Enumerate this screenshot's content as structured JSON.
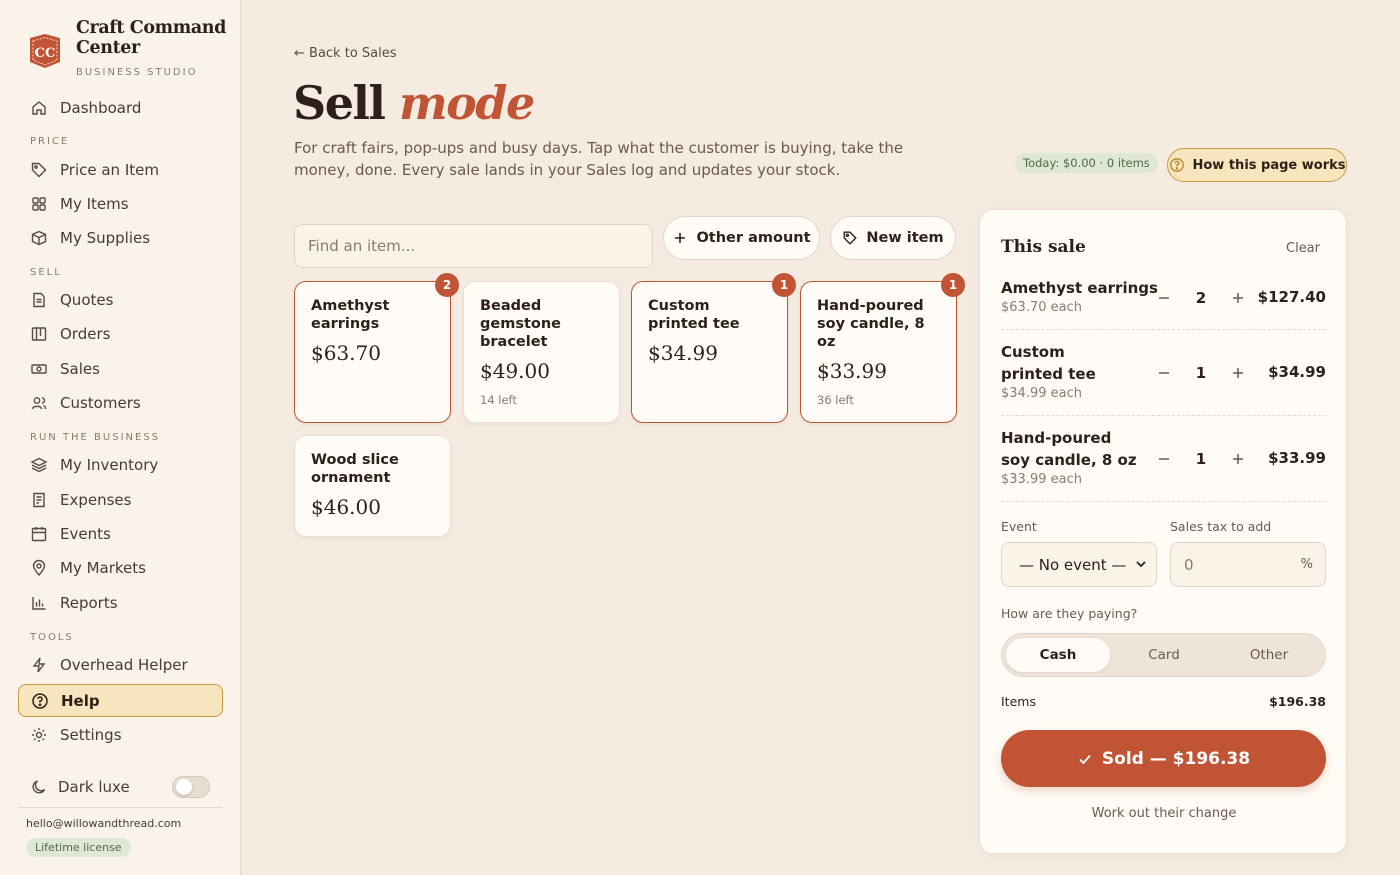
{
  "brand": {
    "name": "Craft Command Center",
    "subtitle": "BUSINESS STUDIO",
    "logo_text": "CC"
  },
  "nav": {
    "dashboard": "Dashboard",
    "sections": {
      "price": "PRICE",
      "sell": "SELL",
      "run": "RUN THE BUSINESS",
      "tools": "TOOLS"
    },
    "price_items": [
      "Price an Item",
      "My Items",
      "My Supplies"
    ],
    "sell_items": [
      "Quotes",
      "Orders",
      "Sales",
      "Customers"
    ],
    "run_items": [
      "My Inventory",
      "Expenses",
      "Events",
      "My Markets",
      "Reports"
    ],
    "tools_items": [
      "Overhead Helper",
      "Help",
      "Settings"
    ],
    "active": "Help"
  },
  "dark_mode": {
    "label": "Dark luxe",
    "enabled": false
  },
  "account": {
    "email": "hello@willowandthread.com",
    "license": "Lifetime license"
  },
  "header": {
    "back_link": "← Back to Sales",
    "title_main": "Sell",
    "title_accent": "mode",
    "description": "For craft fairs, pop-ups and busy days. Tap what the customer is buying, take the money, done. Every sale lands in your Sales log and updates your stock.",
    "today_summary": "Today: $0.00 · 0 items",
    "how_button": "How this page works"
  },
  "toolbar": {
    "search_placeholder": "Find an item...",
    "other_amount": "Other amount",
    "new_item": "New item"
  },
  "products": [
    {
      "name": "Amethyst earrings",
      "price": "$63.70",
      "stock": "",
      "count": "2"
    },
    {
      "name": "Beaded gemstone bracelet",
      "price": "$49.00",
      "stock": "14 left",
      "count": ""
    },
    {
      "name": "Custom printed tee",
      "price": "$34.99",
      "stock": "",
      "count": "1"
    },
    {
      "name": "Hand-poured soy candle, 8 oz",
      "price": "$33.99",
      "stock": "36 left",
      "count": "1"
    },
    {
      "name": "Wood slice ornament",
      "price": "$46.00",
      "stock": "",
      "count": ""
    }
  ],
  "sale": {
    "title": "This sale",
    "clear": "Clear",
    "lines": [
      {
        "name": "Amethyst earrings",
        "each": "$63.70 each",
        "qty": "2",
        "total": "$127.40"
      },
      {
        "name": "Custom printed tee",
        "each": "$34.99 each",
        "qty": "1",
        "total": "$34.99"
      },
      {
        "name": "Hand-poured soy candle, 8 oz",
        "each": "$33.99 each",
        "qty": "1",
        "total": "$33.99"
      }
    ],
    "event_label": "Event",
    "event_value": "— No event —",
    "tax_label": "Sales tax to add",
    "tax_placeholder": "0",
    "tax_unit": "%",
    "payment_label": "How are they paying?",
    "payment_options": [
      "Cash",
      "Card",
      "Other"
    ],
    "payment_selected": "Cash",
    "items_label": "Items",
    "items_total": "$196.38",
    "sold_button": "Sold — $196.38",
    "change_link": "Work out their change"
  },
  "colors": {
    "accent": "#c05434",
    "gold": "#c79a3c",
    "background": "#f5ebe0",
    "success": "#4f6b44"
  }
}
